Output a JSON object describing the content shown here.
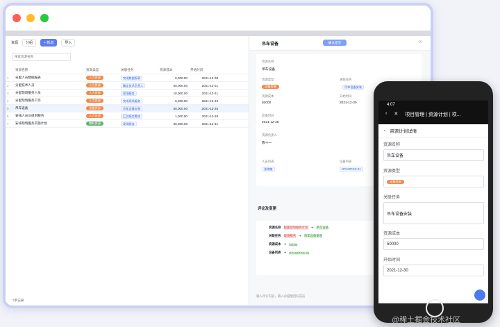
{
  "toolbar": {
    "title": "资源",
    "filter": "分组",
    "add": "+ 新增",
    "import": "导入",
    "search_placeholder": "搜索资源名称"
  },
  "table": {
    "headers": [
      "资源名称",
      "资源类型",
      "关联任务",
      "资源成本",
      "开始时间"
    ],
    "rows": [
      {
        "n": "1",
        "name": "分配人员数据报表",
        "type": "人力资源",
        "task": "完成数据报表",
        "cost": "5,000.00",
        "date": "2021-12-08"
      },
      {
        "n": "2",
        "name": "分配技术人员",
        "type": "人力资源",
        "task": "确定技术负责人",
        "cost": "50,000.00",
        "date": "2021-12-01"
      },
      {
        "n": "3",
        "name": "分配现场服务人员",
        "type": "人力资源",
        "task": "现场服务",
        "cost": "10,000.00",
        "date": "2021-12-21"
      },
      {
        "n": "4",
        "name": "分配现场服务工作",
        "type": "人力资源",
        "task": "完成现场服务",
        "cost": "6,000.00",
        "date": "2021-12-23"
      },
      {
        "n": "5",
        "name": "吊车设备",
        "type": "设备资源",
        "task": "吊车设备安装",
        "cost": "50,000.00",
        "date": "2021-12-25"
      },
      {
        "n": "6",
        "name": "安排人员与组织服务",
        "type": "人力资源",
        "task": "汇总服务需求",
        "cost": "1,000.00",
        "date": "2021-12-28"
      },
      {
        "n": "7",
        "name": "安排现场服务实施计划",
        "type": "物料资源",
        "task": "现场服务",
        "cost": "60,000.00",
        "date": "2021-12-31"
      }
    ],
    "footer": "7条记录"
  },
  "detail": {
    "title": "吊车设备",
    "button": "确认提交",
    "name_label": "资源名称",
    "name": "吊车设备",
    "type_label": "资源类型",
    "type": "设备资源",
    "task_label": "关联任务",
    "task": "吊车设备安装",
    "cost_label": "资源成本",
    "cost": "50000",
    "start_label": "开始时间",
    "start": "2021-12-30",
    "end_label": "结束时间",
    "end": "2021-12-25",
    "owner_label": "资源负责人",
    "owner": "陈十一",
    "people_label": "人员列表",
    "people": "张晓敏",
    "equip_label": "设备列表",
    "equip": "GPL007GC-01",
    "comments_title": "评论及变更",
    "comment_placeholder": "输入评论内容，输入@提醒团队成员",
    "changes": [
      {
        "field": "资源名称",
        "old": "配置现场服务计划",
        "new": "吊车设备"
      },
      {
        "field": "关联任务",
        "old": "现场服务",
        "new": "吊车设备安装"
      },
      {
        "field": "资源成本",
        "old": "",
        "new": "50000"
      },
      {
        "field": "设备列表",
        "old": "",
        "new": "GPL007GC-01"
      }
    ]
  },
  "mobile": {
    "time": "4:07",
    "header": "项目管理 | 资源计划 | 项...",
    "subtitle": "资源计划详情",
    "name_label": "资源名称",
    "name": "吊车设备",
    "type_label": "资源类型",
    "type": "设备资源",
    "task_label": "关联任务",
    "task": "吊车设备安装",
    "cost_label": "资源成本",
    "cost": "50000",
    "start_label": "开始时间",
    "start": "2021-12-30"
  },
  "watermark": "@稀土掘金技术社区"
}
